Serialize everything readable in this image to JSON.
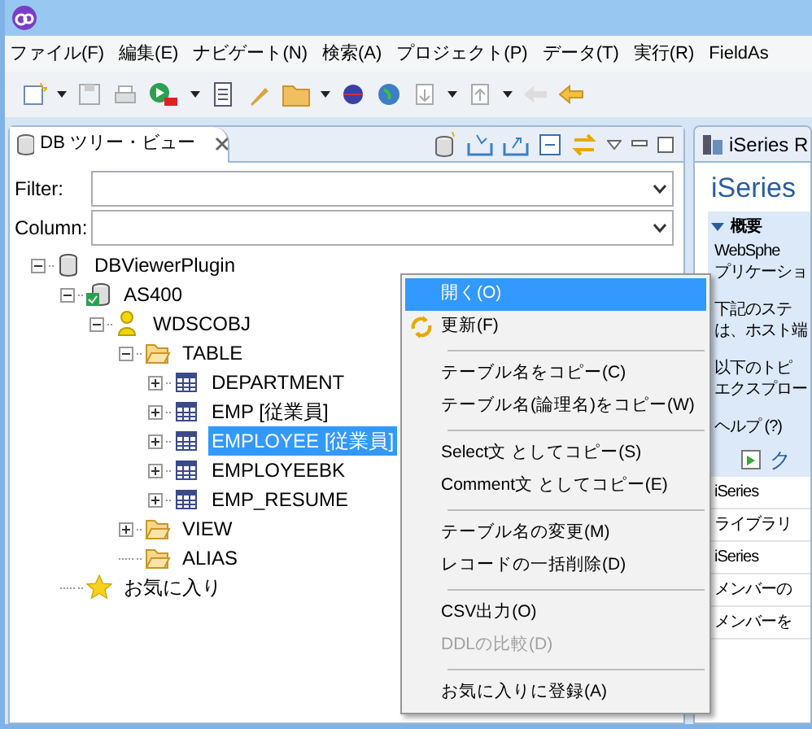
{
  "menu_bar": [
    "ファイル(F)",
    "編集(E)",
    "ナビゲート(N)",
    "検索(A)",
    "プロジェクト(P)",
    "データ(T)",
    "実行(R)",
    "FieldAs"
  ],
  "view": {
    "tab": "DB ツリー・ビュー",
    "filter_label": "Filter:",
    "column_label": "Column:",
    "tree": [
      {
        "label": "DBViewerPlugin",
        "kind": "database",
        "expanded": true,
        "selected": false,
        "children": [
          {
            "label": "AS400",
            "kind": "connection",
            "expanded": true,
            "selected": false,
            "children": [
              {
                "label": "WDSCOBJ",
                "kind": "schema",
                "expanded": true,
                "selected": false,
                "children": [
                  {
                    "label": "TABLE",
                    "kind": "folder",
                    "expanded": true,
                    "selected": false,
                    "children": [
                      {
                        "label": "DEPARTMENT",
                        "kind": "table",
                        "expanded": false,
                        "selected": false
                      },
                      {
                        "label": "EMP [従業員]",
                        "kind": "table",
                        "expanded": false,
                        "selected": false
                      },
                      {
                        "label": "EMPLOYEE [従業員]",
                        "kind": "table",
                        "expanded": false,
                        "selected": true
                      },
                      {
                        "label": "EMPLOYEEBK",
                        "kind": "table",
                        "expanded": false,
                        "selected": false
                      },
                      {
                        "label": "EMP_RESUME",
                        "kind": "table",
                        "expanded": false,
                        "selected": false
                      }
                    ]
                  },
                  {
                    "label": "VIEW",
                    "kind": "folder",
                    "expanded": false,
                    "selected": false
                  },
                  {
                    "label": "ALIAS",
                    "kind": "folder",
                    "selected": false
                  }
                ]
              }
            ]
          },
          {
            "label": "お気に入り",
            "kind": "favorite",
            "selected": false
          }
        ]
      }
    ]
  },
  "context_menu": [
    [
      {
        "label": "開く(O)",
        "selected": true,
        "disabled": false
      },
      {
        "label": "更新(F)",
        "selected": false,
        "disabled": false
      }
    ],
    [
      {
        "label": "テーブル名をコピー(C)",
        "selected": false,
        "disabled": false
      },
      {
        "label": "テーブル名(論理名)をコピー(W)",
        "selected": false,
        "disabled": false
      }
    ],
    [
      {
        "label": "Select文 としてコピー(S)",
        "selected": false,
        "disabled": false
      },
      {
        "label": "Comment文 としてコピー(E)",
        "selected": false,
        "disabled": false
      }
    ],
    [
      {
        "label": "テーブル名の変更(M)",
        "selected": false,
        "disabled": false
      },
      {
        "label": "レコードの一括削除(D)",
        "selected": false,
        "disabled": false
      }
    ],
    [
      {
        "label": "CSV出力(O)",
        "selected": false,
        "disabled": false
      },
      {
        "label": "DDLの比較(D)",
        "selected": false,
        "disabled": true
      }
    ],
    [
      {
        "label": "お気に入りに登録(A)",
        "selected": false,
        "disabled": false
      }
    ]
  ],
  "right_panel": {
    "tab": "iSeries R",
    "heading": "iSeries",
    "section": "概要",
    "paragraphs": [
      [
        "WebSphe",
        "プリケーショ"
      ],
      [
        "下記のステ",
        "は、ホスト端"
      ],
      [
        "以下のトピ",
        "エクスプロー"
      ]
    ],
    "help": "ヘルプ (?)",
    "help_link": "ク",
    "list": [
      "iSeries",
      "ライブラリ",
      "iSeries",
      "メンバーの",
      "メンバーを"
    ]
  }
}
